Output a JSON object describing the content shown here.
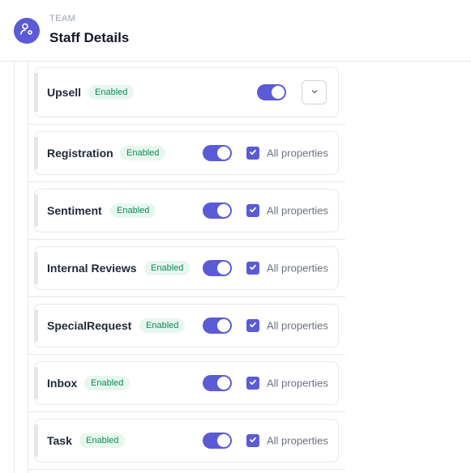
{
  "header": {
    "eyebrow": "TEAM",
    "title": "Staff Details",
    "icon": "user-cog-icon"
  },
  "modules": [
    {
      "name": "Upsell",
      "status": "Enabled",
      "enabled": true,
      "control": "expand"
    },
    {
      "name": "Registration",
      "status": "Enabled",
      "enabled": true,
      "control": "checkbox",
      "checkbox_label": "All properties",
      "checked": true
    },
    {
      "name": "Sentiment",
      "status": "Enabled",
      "enabled": true,
      "control": "checkbox",
      "checkbox_label": "All properties",
      "checked": true
    },
    {
      "name": "Internal Reviews",
      "status": "Enabled",
      "enabled": true,
      "control": "checkbox",
      "checkbox_label": "All properties",
      "checked": true
    },
    {
      "name": "SpecialRequest",
      "status": "Enabled",
      "enabled": true,
      "control": "checkbox",
      "checkbox_label": "All properties",
      "checked": true
    },
    {
      "name": "Inbox",
      "status": "Enabled",
      "enabled": true,
      "control": "checkbox",
      "checkbox_label": "All properties",
      "checked": true
    },
    {
      "name": "Task",
      "status": "Enabled",
      "enabled": true,
      "control": "checkbox",
      "checkbox_label": "All properties",
      "checked": true
    }
  ],
  "colors": {
    "accent": "#5b5bd6",
    "badge_text": "#0f8a55",
    "badge_bg": "#e7f7ef"
  }
}
